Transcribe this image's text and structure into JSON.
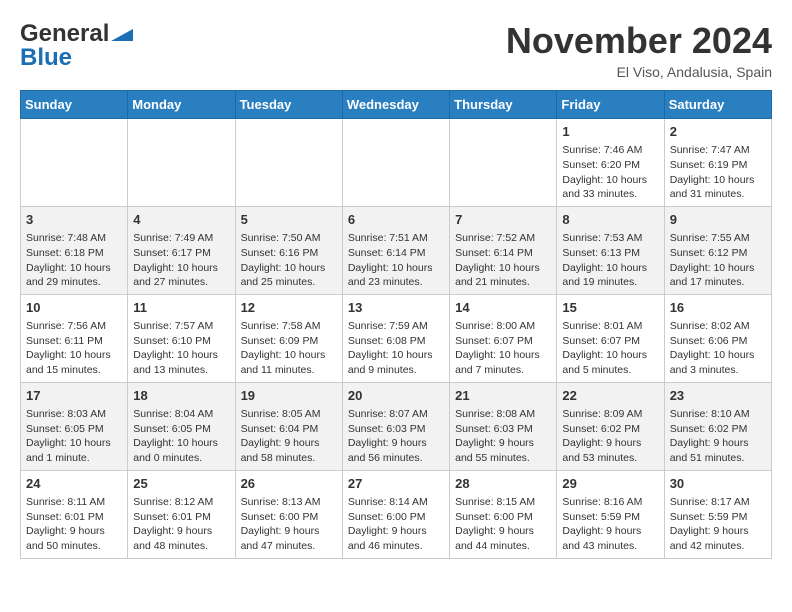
{
  "header": {
    "logo_line1": "General",
    "logo_line2": "Blue",
    "month_title": "November 2024",
    "location": "El Viso, Andalusia, Spain"
  },
  "days_of_week": [
    "Sunday",
    "Monday",
    "Tuesday",
    "Wednesday",
    "Thursday",
    "Friday",
    "Saturday"
  ],
  "weeks": [
    [
      {
        "day": "",
        "text": ""
      },
      {
        "day": "",
        "text": ""
      },
      {
        "day": "",
        "text": ""
      },
      {
        "day": "",
        "text": ""
      },
      {
        "day": "",
        "text": ""
      },
      {
        "day": "1",
        "text": "Sunrise: 7:46 AM\nSunset: 6:20 PM\nDaylight: 10 hours and 33 minutes."
      },
      {
        "day": "2",
        "text": "Sunrise: 7:47 AM\nSunset: 6:19 PM\nDaylight: 10 hours and 31 minutes."
      }
    ],
    [
      {
        "day": "3",
        "text": "Sunrise: 7:48 AM\nSunset: 6:18 PM\nDaylight: 10 hours and 29 minutes."
      },
      {
        "day": "4",
        "text": "Sunrise: 7:49 AM\nSunset: 6:17 PM\nDaylight: 10 hours and 27 minutes."
      },
      {
        "day": "5",
        "text": "Sunrise: 7:50 AM\nSunset: 6:16 PM\nDaylight: 10 hours and 25 minutes."
      },
      {
        "day": "6",
        "text": "Sunrise: 7:51 AM\nSunset: 6:14 PM\nDaylight: 10 hours and 23 minutes."
      },
      {
        "day": "7",
        "text": "Sunrise: 7:52 AM\nSunset: 6:14 PM\nDaylight: 10 hours and 21 minutes."
      },
      {
        "day": "8",
        "text": "Sunrise: 7:53 AM\nSunset: 6:13 PM\nDaylight: 10 hours and 19 minutes."
      },
      {
        "day": "9",
        "text": "Sunrise: 7:55 AM\nSunset: 6:12 PM\nDaylight: 10 hours and 17 minutes."
      }
    ],
    [
      {
        "day": "10",
        "text": "Sunrise: 7:56 AM\nSunset: 6:11 PM\nDaylight: 10 hours and 15 minutes."
      },
      {
        "day": "11",
        "text": "Sunrise: 7:57 AM\nSunset: 6:10 PM\nDaylight: 10 hours and 13 minutes."
      },
      {
        "day": "12",
        "text": "Sunrise: 7:58 AM\nSunset: 6:09 PM\nDaylight: 10 hours and 11 minutes."
      },
      {
        "day": "13",
        "text": "Sunrise: 7:59 AM\nSunset: 6:08 PM\nDaylight: 10 hours and 9 minutes."
      },
      {
        "day": "14",
        "text": "Sunrise: 8:00 AM\nSunset: 6:07 PM\nDaylight: 10 hours and 7 minutes."
      },
      {
        "day": "15",
        "text": "Sunrise: 8:01 AM\nSunset: 6:07 PM\nDaylight: 10 hours and 5 minutes."
      },
      {
        "day": "16",
        "text": "Sunrise: 8:02 AM\nSunset: 6:06 PM\nDaylight: 10 hours and 3 minutes."
      }
    ],
    [
      {
        "day": "17",
        "text": "Sunrise: 8:03 AM\nSunset: 6:05 PM\nDaylight: 10 hours and 1 minute."
      },
      {
        "day": "18",
        "text": "Sunrise: 8:04 AM\nSunset: 6:05 PM\nDaylight: 10 hours and 0 minutes."
      },
      {
        "day": "19",
        "text": "Sunrise: 8:05 AM\nSunset: 6:04 PM\nDaylight: 9 hours and 58 minutes."
      },
      {
        "day": "20",
        "text": "Sunrise: 8:07 AM\nSunset: 6:03 PM\nDaylight: 9 hours and 56 minutes."
      },
      {
        "day": "21",
        "text": "Sunrise: 8:08 AM\nSunset: 6:03 PM\nDaylight: 9 hours and 55 minutes."
      },
      {
        "day": "22",
        "text": "Sunrise: 8:09 AM\nSunset: 6:02 PM\nDaylight: 9 hours and 53 minutes."
      },
      {
        "day": "23",
        "text": "Sunrise: 8:10 AM\nSunset: 6:02 PM\nDaylight: 9 hours and 51 minutes."
      }
    ],
    [
      {
        "day": "24",
        "text": "Sunrise: 8:11 AM\nSunset: 6:01 PM\nDaylight: 9 hours and 50 minutes."
      },
      {
        "day": "25",
        "text": "Sunrise: 8:12 AM\nSunset: 6:01 PM\nDaylight: 9 hours and 48 minutes."
      },
      {
        "day": "26",
        "text": "Sunrise: 8:13 AM\nSunset: 6:00 PM\nDaylight: 9 hours and 47 minutes."
      },
      {
        "day": "27",
        "text": "Sunrise: 8:14 AM\nSunset: 6:00 PM\nDaylight: 9 hours and 46 minutes."
      },
      {
        "day": "28",
        "text": "Sunrise: 8:15 AM\nSunset: 6:00 PM\nDaylight: 9 hours and 44 minutes."
      },
      {
        "day": "29",
        "text": "Sunrise: 8:16 AM\nSunset: 5:59 PM\nDaylight: 9 hours and 43 minutes."
      },
      {
        "day": "30",
        "text": "Sunrise: 8:17 AM\nSunset: 5:59 PM\nDaylight: 9 hours and 42 minutes."
      }
    ]
  ]
}
